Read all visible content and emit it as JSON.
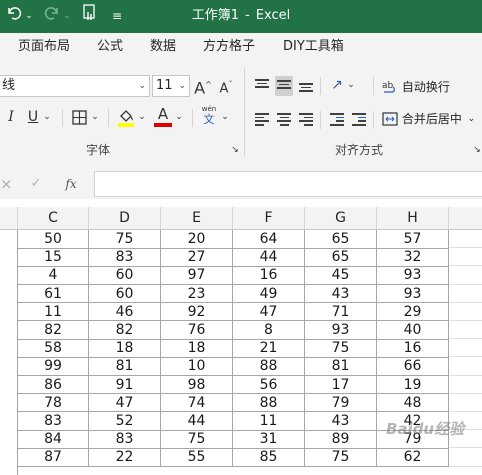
{
  "titlebar": {
    "workbook": "工作簿1",
    "separator": "-",
    "app": "Excel",
    "icons": [
      "undo-icon",
      "redo-icon",
      "touch-mode-icon",
      "customize-quick-access-icon"
    ]
  },
  "menu": [
    "页面布局",
    "公式",
    "数据",
    "方方格子",
    "DIY工具箱"
  ],
  "ribbon": {
    "font_name": "线",
    "font_size": "11",
    "grow_font": "A",
    "shrink_font": "A",
    "italic": "I",
    "underline": "U",
    "font_color_letter": "A",
    "phonetic_top": "wén",
    "phonetic_bottom": "文",
    "font_group_label": "字体",
    "wrap_text_label": "自动换行",
    "merge_center_label": "合并后居中",
    "align_group_label": "对齐方式",
    "colors": {
      "highlight": "#ffff00",
      "font_color": "#e00000",
      "accent": "#217346"
    }
  },
  "formula_bar": {
    "fx": "fx",
    "cancel": "×",
    "enter": "✓",
    "value": ""
  },
  "columns": [
    "C",
    "D",
    "E",
    "F",
    "G",
    "H"
  ],
  "rows": [
    [
      "50",
      "75",
      "20",
      "64",
      "65",
      "57"
    ],
    [
      "15",
      "83",
      "27",
      "44",
      "65",
      "32"
    ],
    [
      "4",
      "60",
      "97",
      "16",
      "45",
      "93"
    ],
    [
      "61",
      "60",
      "23",
      "49",
      "43",
      "93"
    ],
    [
      "11",
      "46",
      "92",
      "47",
      "71",
      "29"
    ],
    [
      "82",
      "82",
      "76",
      "8",
      "93",
      "40"
    ],
    [
      "58",
      "18",
      "18",
      "21",
      "75",
      "16"
    ],
    [
      "99",
      "81",
      "10",
      "88",
      "81",
      "66"
    ],
    [
      "86",
      "91",
      "98",
      "56",
      "17",
      "19"
    ],
    [
      "78",
      "47",
      "74",
      "88",
      "79",
      "48"
    ],
    [
      "83",
      "52",
      "44",
      "11",
      "43",
      "42"
    ],
    [
      "84",
      "83",
      "75",
      "31",
      "89",
      "79"
    ],
    [
      "87",
      "22",
      "55",
      "85",
      "75",
      "62"
    ]
  ],
  "watermark": "Baidu经验"
}
